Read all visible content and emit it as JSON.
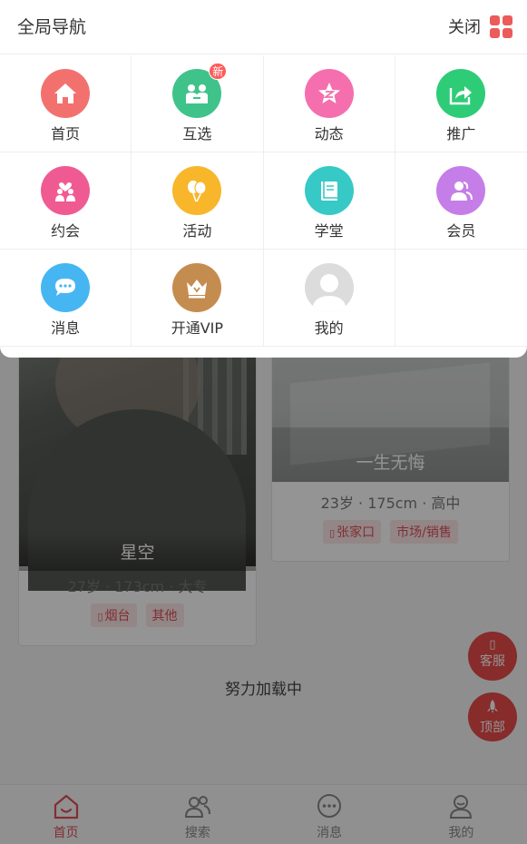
{
  "nav": {
    "title": "全局导航",
    "close_label": "关闭",
    "items": [
      {
        "label": "首页",
        "icon": "home-icon",
        "color": "#f2716f",
        "badge": ""
      },
      {
        "label": "互选",
        "icon": "couple-icon",
        "color": "#3fc38a",
        "badge": "新"
      },
      {
        "label": "动态",
        "icon": "star-icon",
        "color": "#f56fae",
        "badge": ""
      },
      {
        "label": "推广",
        "icon": "share-icon",
        "color": "#2fcc78",
        "badge": ""
      },
      {
        "label": "约会",
        "icon": "date-icon",
        "color": "#f05a92",
        "badge": ""
      },
      {
        "label": "活动",
        "icon": "balloon-icon",
        "color": "#f8b62b",
        "badge": ""
      },
      {
        "label": "学堂",
        "icon": "book-icon",
        "color": "#36c9c6",
        "badge": ""
      },
      {
        "label": "会员",
        "icon": "members-icon",
        "color": "#c57ee8",
        "badge": ""
      },
      {
        "label": "消息",
        "icon": "message-icon",
        "color": "#46b6f2",
        "badge": ""
      },
      {
        "label": "开通VIP",
        "icon": "crown-icon",
        "color": "#c58c4f",
        "badge": ""
      },
      {
        "label": "我的",
        "icon": "user-avatar-icon",
        "color": "#d6d6d6",
        "badge": ""
      }
    ]
  },
  "cards": [
    {
      "name": "星空",
      "meta": "27岁 · 173cm · 大专",
      "tags": [
        "烟台",
        "其他"
      ]
    },
    {
      "name": "一生无悔",
      "meta": "23岁 · 175cm · 高中",
      "tags": [
        "张家口",
        "市场/销售"
      ]
    }
  ],
  "loading_text": "努力加载中",
  "floating": {
    "service": "客服",
    "top": "顶部"
  },
  "tabbar": [
    {
      "label": "首页",
      "icon": "home-outline-icon",
      "active": true
    },
    {
      "label": "搜索",
      "icon": "people-search-icon",
      "active": false
    },
    {
      "label": "消息",
      "icon": "chat-bubble-icon",
      "active": false
    },
    {
      "label": "我的",
      "icon": "profile-icon",
      "active": false
    }
  ],
  "colors": {
    "accent": "#e0505a",
    "float_button": "#e84b4b",
    "grid_icon": "#ec5a5a"
  }
}
